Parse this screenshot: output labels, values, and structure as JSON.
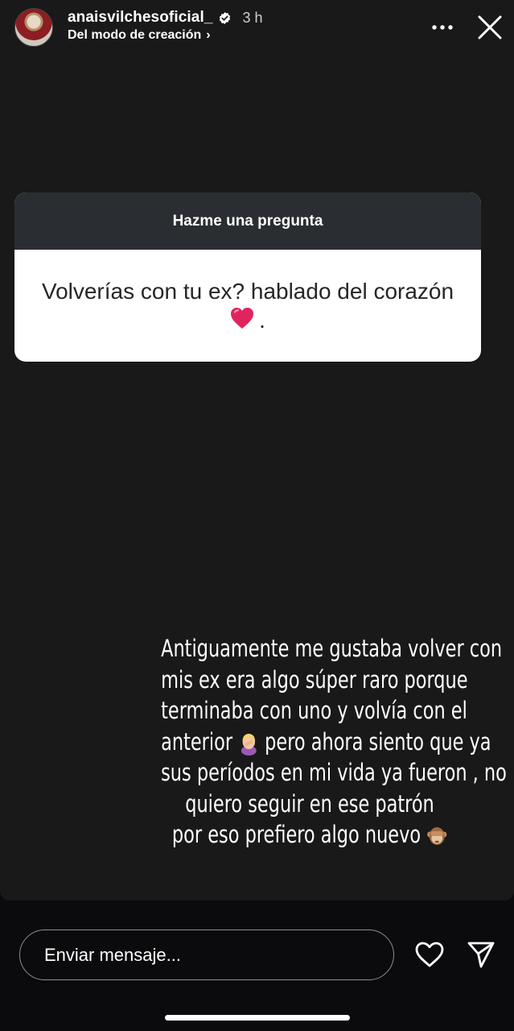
{
  "header": {
    "username": "anaisvilchesoficial_",
    "time": "3 h",
    "subtitle": "Del modo de creación",
    "subtitle_chevron": "›"
  },
  "question": {
    "title": "Hazme una pregunta",
    "text": "Volverías con tu ex? hablado del corazón",
    "suffix": "."
  },
  "answer": {
    "lines": [
      "Antiguamente me gustaba volver con",
      "mis ex era algo súper raro porque",
      "terminaba con uno y volvía con el",
      "pero ahora siento que ya",
      "sus períodos en mi vida ya fueron , no",
      "quiero seguir en ese patrón",
      "por eso prefiero algo nuevo"
    ],
    "line4_prefix": "anterior"
  },
  "footer": {
    "message_placeholder": "Enviar mensaje..."
  },
  "icons": {
    "verified": "verified-badge-icon",
    "more": "more-options-icon",
    "close": "close-icon",
    "heart": "heart-icon",
    "send": "send-icon"
  },
  "colors": {
    "story_background": "#191919",
    "card_header": "#2a2d31",
    "card_body": "#ffffff",
    "heart_red": "#e0245e"
  }
}
